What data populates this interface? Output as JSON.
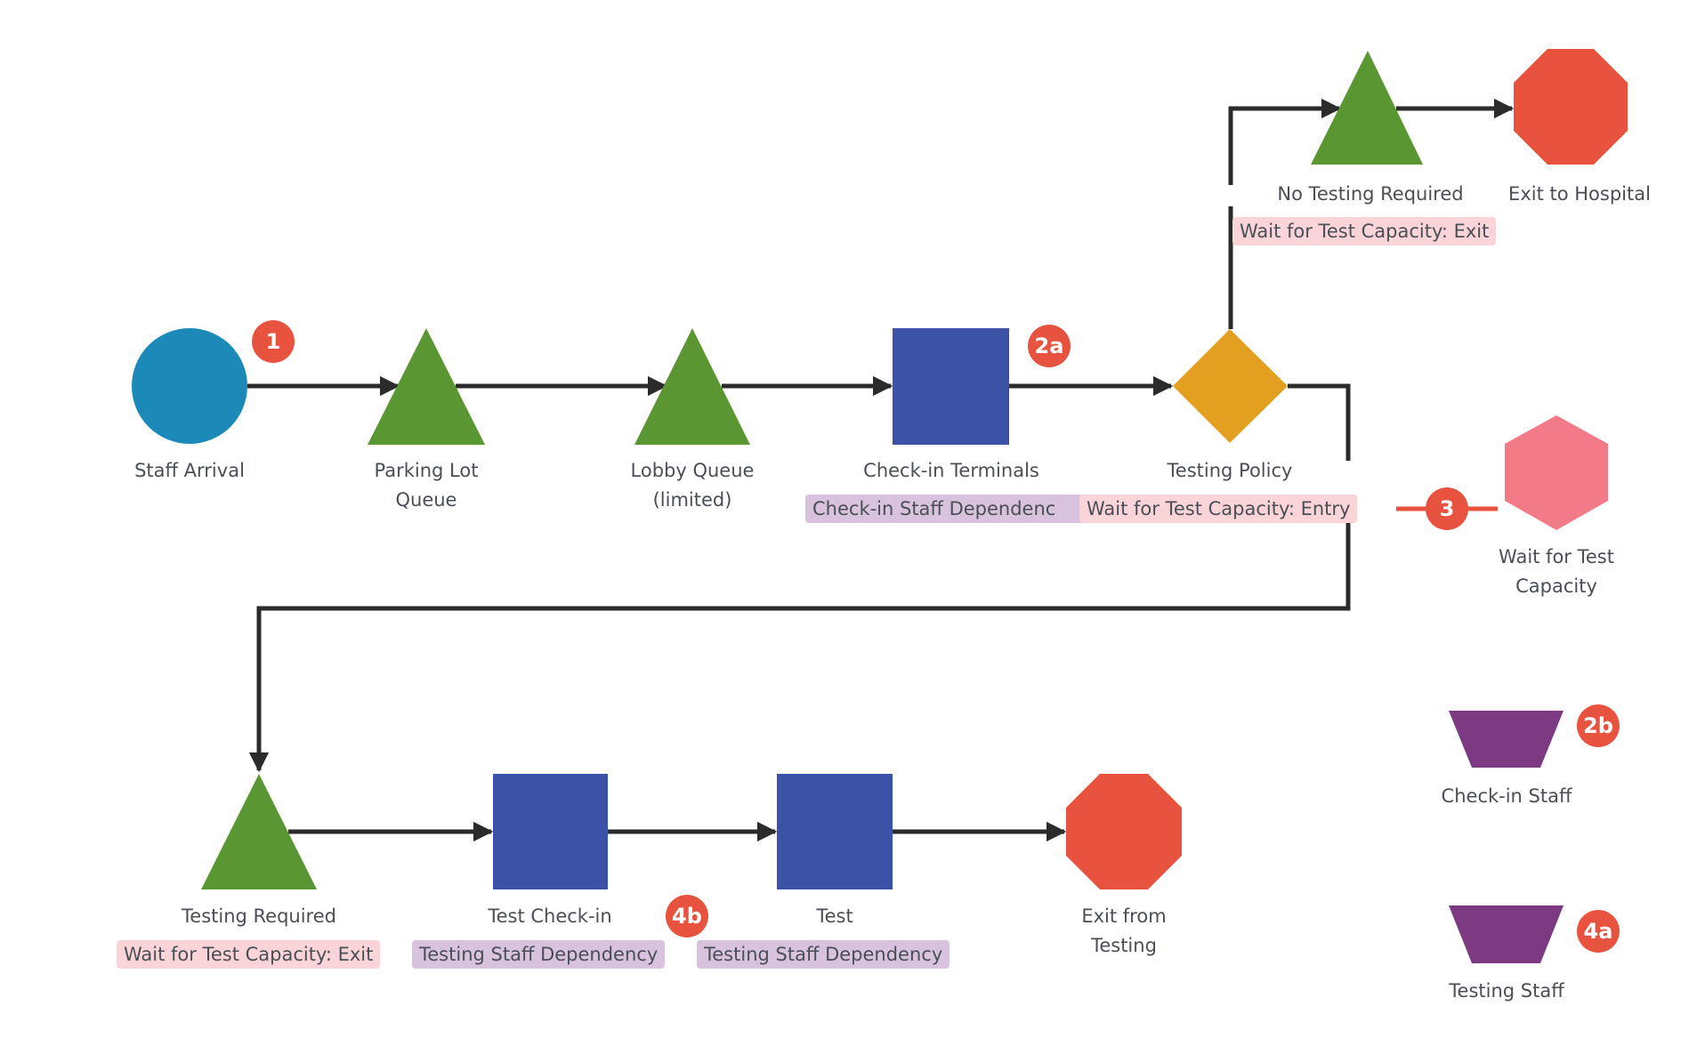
{
  "colors": {
    "start": "#1b8ab8",
    "queue": "#5a9632",
    "process": "#3c52a6",
    "decision": "#e29f20",
    "exit": "#e8533f",
    "wait": "#f27b87",
    "resource": "#7d3a82",
    "badge": "#e8533f",
    "connector": "#2b2b2b",
    "tag_pink": "#fad4d8",
    "tag_purple": "#d9c2de"
  },
  "nodes": {
    "staff_arrival": {
      "label": "Staff Arrival",
      "shape": "circle"
    },
    "parking_lot": {
      "label_line1": "Parking Lot",
      "label_line2": "Queue",
      "shape": "triangle"
    },
    "lobby_queue": {
      "label_line1": "Lobby Queue",
      "label_line2": "(limited)",
      "shape": "triangle"
    },
    "checkin_terminals": {
      "label": "Check-in Terminals",
      "shape": "square",
      "tag": "Check-in Staff Dependenc"
    },
    "testing_policy": {
      "label": "Testing Policy",
      "shape": "diamond",
      "tag": "Wait for Test Capacity: Entry"
    },
    "no_testing_required": {
      "label": "No Testing Required",
      "shape": "triangle",
      "tag": "Wait for Test Capacity: Exit"
    },
    "exit_to_hospital": {
      "label": "Exit to Hospital",
      "shape": "octagon"
    },
    "wait_for_test_capacity": {
      "label_line1": "Wait for Test",
      "label_line2": "Capacity",
      "shape": "hexagon"
    },
    "testing_required": {
      "label": "Testing Required",
      "shape": "triangle",
      "tag": "Wait for Test Capacity: Exit"
    },
    "test_checkin": {
      "label": "Test Check-in",
      "shape": "square",
      "tag": "Testing Staff Dependency"
    },
    "test": {
      "label": "Test",
      "shape": "square",
      "tag": "Testing Staff Dependency"
    },
    "exit_from_testing": {
      "label_line1": "Exit from",
      "label_line2": "Testing",
      "shape": "octagon"
    },
    "checkin_staff": {
      "label": "Check-in Staff",
      "shape": "trapezoid"
    },
    "testing_staff": {
      "label": "Testing Staff",
      "shape": "trapezoid"
    }
  },
  "badges": {
    "b1": "1",
    "b2a": "2a",
    "b2b": "2b",
    "b3": "3",
    "b4a": "4a",
    "b4b": "4b"
  }
}
